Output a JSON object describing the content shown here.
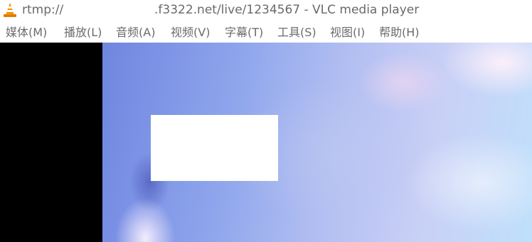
{
  "window": {
    "title_prefix": "rtmp://",
    "title_suffix": ".f3322.net/live/1234567 - VLC media player",
    "app_icon": "vlc-cone-icon"
  },
  "menu": {
    "items": [
      {
        "label": "媒体(M)"
      },
      {
        "label": "播放(L)"
      },
      {
        "label": "音频(A)"
      },
      {
        "label": "视频(V)"
      },
      {
        "label": "字幕(T)"
      },
      {
        "label": "工具(S)"
      },
      {
        "label": "视图(I)"
      },
      {
        "label": "帮助(H)"
      }
    ]
  },
  "colors": {
    "text": "#6a6a6a",
    "vlc_orange": "#f08c00",
    "letterbox": "#000000"
  }
}
